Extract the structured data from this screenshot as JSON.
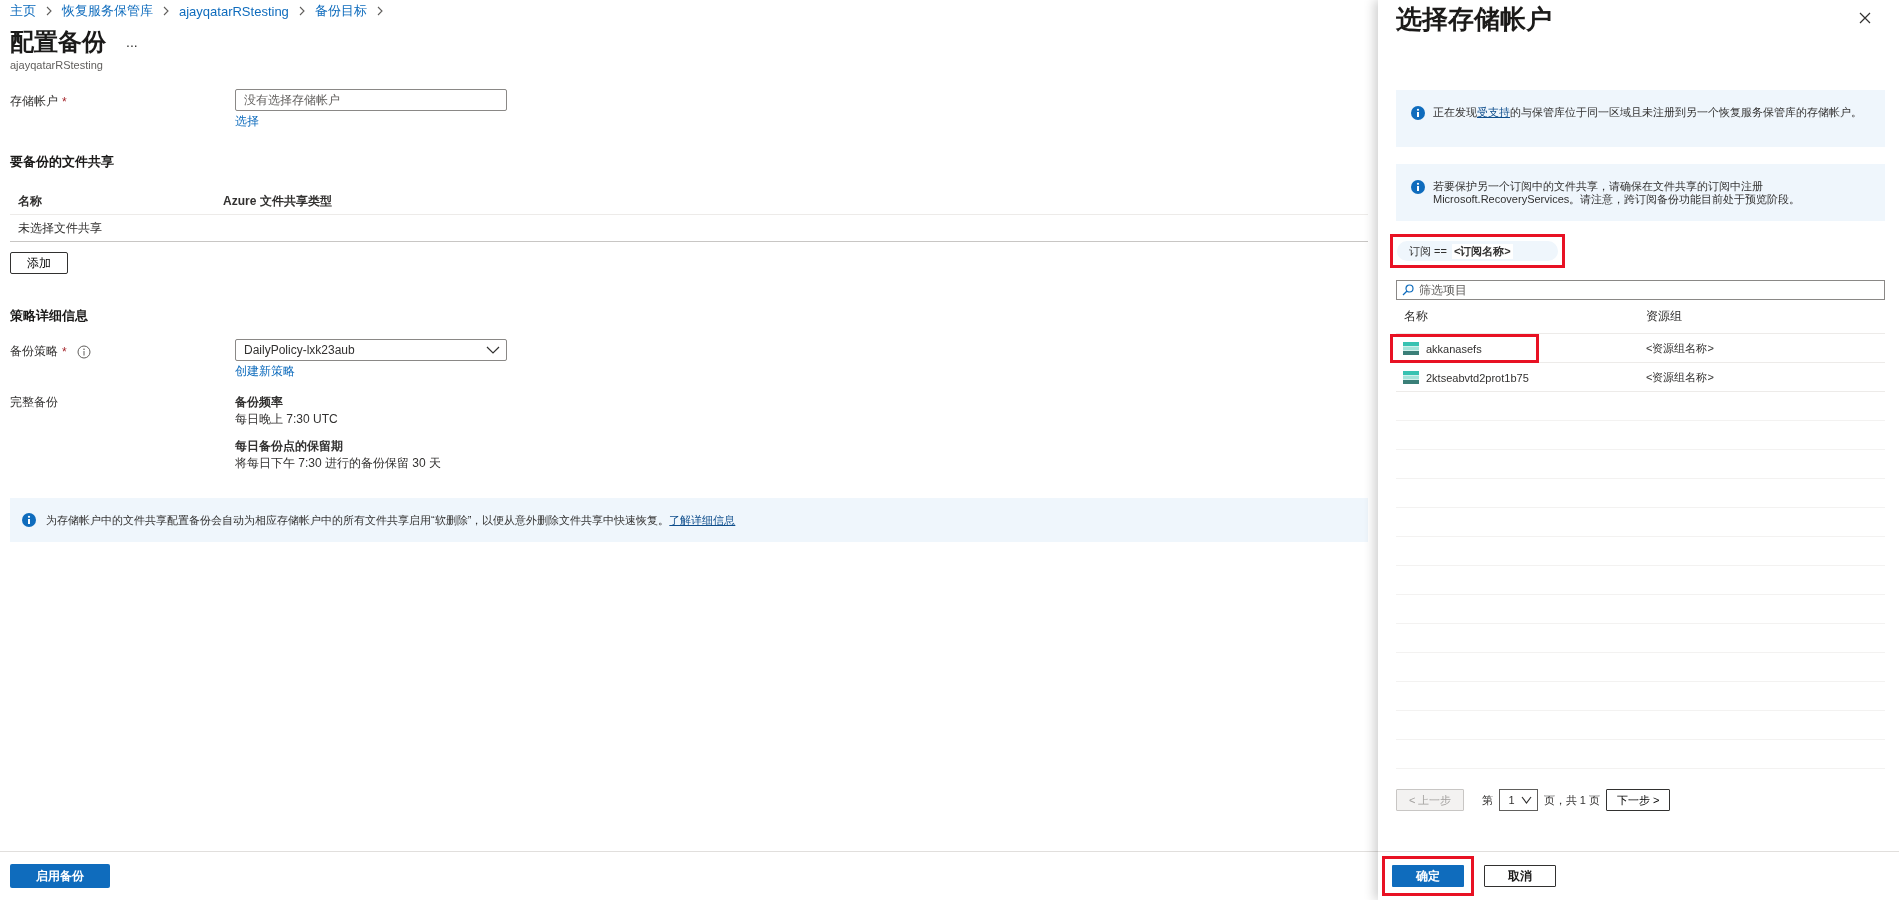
{
  "breadcrumb": [
    {
      "label": "主页"
    },
    {
      "label": "恢复服务保管库"
    },
    {
      "label": "ajayqatarRStesting"
    },
    {
      "label": "备份目标"
    }
  ],
  "page": {
    "title": "配置备份",
    "more": "...",
    "subtitle": "ajayqatarRStesting"
  },
  "storage_account": {
    "label": "存储帐户",
    "required_mark": "*",
    "placeholder": "没有选择存储帐户",
    "link": "选择"
  },
  "file_shares": {
    "heading": "要备份的文件共享",
    "columns": [
      "名称",
      "Azure 文件共享类型"
    ],
    "empty_text": "未选择文件共享",
    "add_button": "添加"
  },
  "policy": {
    "heading": "策略详细信息",
    "label": "备份策略",
    "required_mark": "*",
    "value": "DailyPolicy-lxk23aub",
    "link": "创建新策略",
    "full_backup_label": "完整备份",
    "details": [
      {
        "title": "备份频率",
        "text": "每日晚上 7:30 UTC"
      },
      {
        "title": "每日备份点的保留期",
        "text": "将每日下午 7:30 进行的备份保留 30 天"
      }
    ]
  },
  "notice": {
    "text": "为存储帐户中的文件共享配置备份会自动为相应存储帐户中的所有文件共享启用“软删除”，以便从意外删除文件共享中快速恢复。",
    "link": "了解详细信息"
  },
  "footer": {
    "primary_button": "启用备份"
  },
  "panel": {
    "title": "选择存储帐户",
    "notices": [
      {
        "text_before": "正在发现",
        "link": "受支持",
        "text_after": "的与保管库位于同一区域且未注册到另一个恢复服务保管库的存储帐户。"
      },
      {
        "text_before": "若要保护另一个订阅中的文件共享，请确保在文件共享的订阅中注册 Microsoft.RecoveryServices。请注意，跨订阅备份功能目前处于预览阶段。"
      }
    ],
    "filter_chip": {
      "label": "订阅 ==",
      "value": "<订阅名称>",
      "highlighted": true
    },
    "search": {
      "placeholder": "筛选项目"
    },
    "columns": [
      "名称",
      "资源组"
    ],
    "rows": [
      {
        "name": "akkanasefs",
        "resource_group": "<资源组名称>",
        "highlighted": true
      },
      {
        "name": "2ktseabvtd2prot1b75",
        "resource_group": "<资源组名称>",
        "highlighted": false
      }
    ],
    "pagination": {
      "prev": "< 上一步",
      "prev_disabled": true,
      "page_prefix": "第",
      "page": "1",
      "page_suffix": "页，共 1 页",
      "next": "下一步 >"
    },
    "buttons": [
      {
        "label": "确定",
        "kind": "primary",
        "highlighted": true
      },
      {
        "label": "取消",
        "kind": "secondary",
        "highlighted": false
      }
    ]
  }
}
